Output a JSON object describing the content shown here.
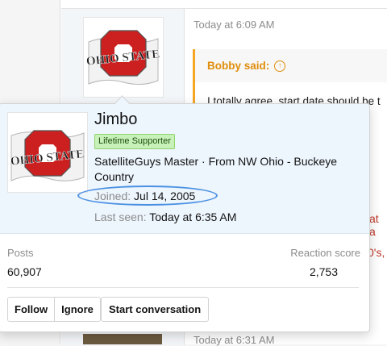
{
  "thread": {
    "post1": {
      "timestamp": "Today at 6:09 AM",
      "quote_author": "Bobby said:",
      "quote_text": "I totally agree, start date should be t"
    },
    "peek_text_1": "at a",
    "peek_text_2": "0's,",
    "post2": {
      "timestamp": "Today at 6:31 AM"
    }
  },
  "member_tooltip": {
    "username": "Jimbo",
    "banner": "Lifetime Supporter",
    "user_title": "SatelliteGuys Master · From NW Ohio - Buckeye Country",
    "joined_label": "Joined:",
    "joined_value": "Jul 14, 2005",
    "last_seen_label": "Last seen:",
    "last_seen_value": "Today at 6:35 AM",
    "stats": {
      "posts_label": "Posts",
      "posts_value": "60,907",
      "reaction_label": "Reaction score",
      "reaction_value": "2,753"
    },
    "buttons": {
      "follow": "Follow",
      "ignore": "Ignore",
      "start_conversation": "Start conversation"
    }
  },
  "avatar": {
    "logo_text": "OHIO STATE",
    "colors": {
      "scarlet": "#cc1f1f",
      "gray": "#2b2b2b"
    }
  },
  "colors": {
    "quote_accent": "#f5a623",
    "tooltip_header_bg": "#edf5fd",
    "badge_bg": "#c8f1b9",
    "highlight_oval": "#4a90e2"
  }
}
